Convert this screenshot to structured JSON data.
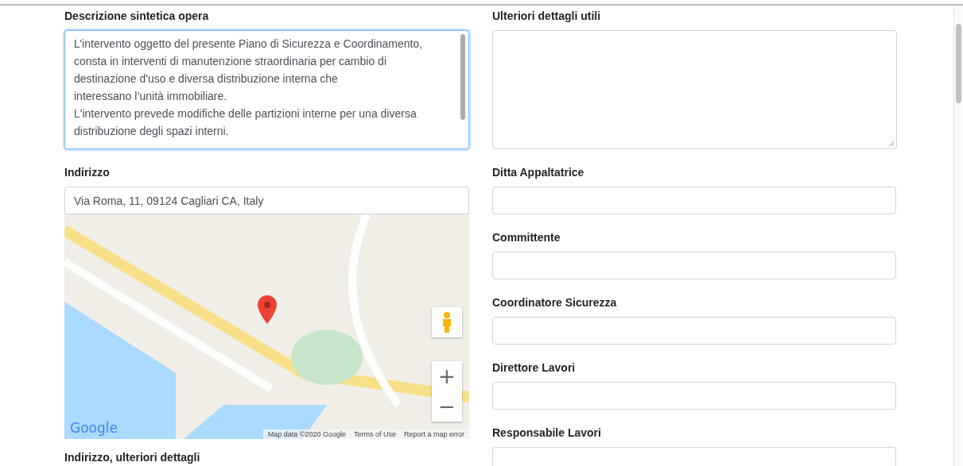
{
  "left": {
    "description": {
      "label": "Descrizione sintetica opera",
      "value": "L’intervento oggetto del presente Piano di Sicurezza e Coordinamento, consta in interventi di manutenzione straordinaria per cambio di destinazione d'uso e diversa distribuzione interna che\ninteressano l’unità immobiliare.\nL'intervento prevede modifiche delle partizioni interne per una diversa distribuzione degli spazi interni.",
      "focused": true
    },
    "address": {
      "label": "Indirizzo",
      "value": "Via Roma, 11, 09124 Cagliari CA, Italy"
    },
    "map": {
      "logo": "Google",
      "footer": [
        "Map data ©2020 Google",
        "Terms of Use",
        "Report a map error"
      ],
      "zoom_in": "+",
      "zoom_out": "−"
    },
    "address_details": {
      "label": "Indirizzo, ulteriori dettagli"
    }
  },
  "right": {
    "details": {
      "label": "Ulteriori dettagli utili",
      "focused": false
    },
    "fields": [
      {
        "label": "Ditta Appaltatrice"
      },
      {
        "label": "Committente"
      },
      {
        "label": "Coordinatore Sicurezza"
      },
      {
        "label": "Direttore Lavori"
      },
      {
        "label": "Responsabile Lavori"
      }
    ]
  }
}
